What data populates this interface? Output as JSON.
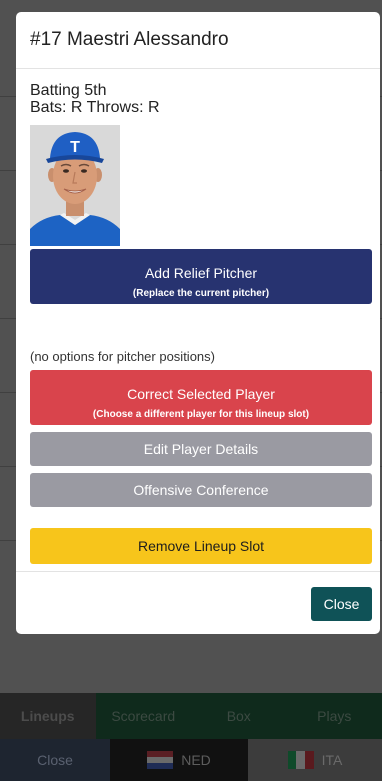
{
  "modal": {
    "title": "#17 Maestri Alessandro",
    "batting": "Batting 5th",
    "bats_throws": "Bats: R Throws: R",
    "cap_letter": "T",
    "relief": {
      "label": "Add Relief Pitcher",
      "sub": "(Replace the current pitcher)"
    },
    "note": "(no options for pitcher positions)",
    "correct": {
      "label": "Correct Selected Player",
      "sub": "(Choose a different player for this lineup slot)"
    },
    "edit_label": "Edit Player Details",
    "conference_label": "Offensive Conference",
    "remove_label": "Remove Lineup Slot",
    "close_label": "Close"
  },
  "background": {
    "tabs": [
      "Lineups",
      "Scorecard",
      "Box",
      "Plays"
    ],
    "close_label": "Close",
    "team_away": "NED",
    "team_home": "ITA"
  },
  "colors": {
    "relief": "#273370",
    "correct": "#d9444c",
    "secondary": "#9a9aa2",
    "remove": "#f7c51b",
    "close": "#0f5257"
  }
}
